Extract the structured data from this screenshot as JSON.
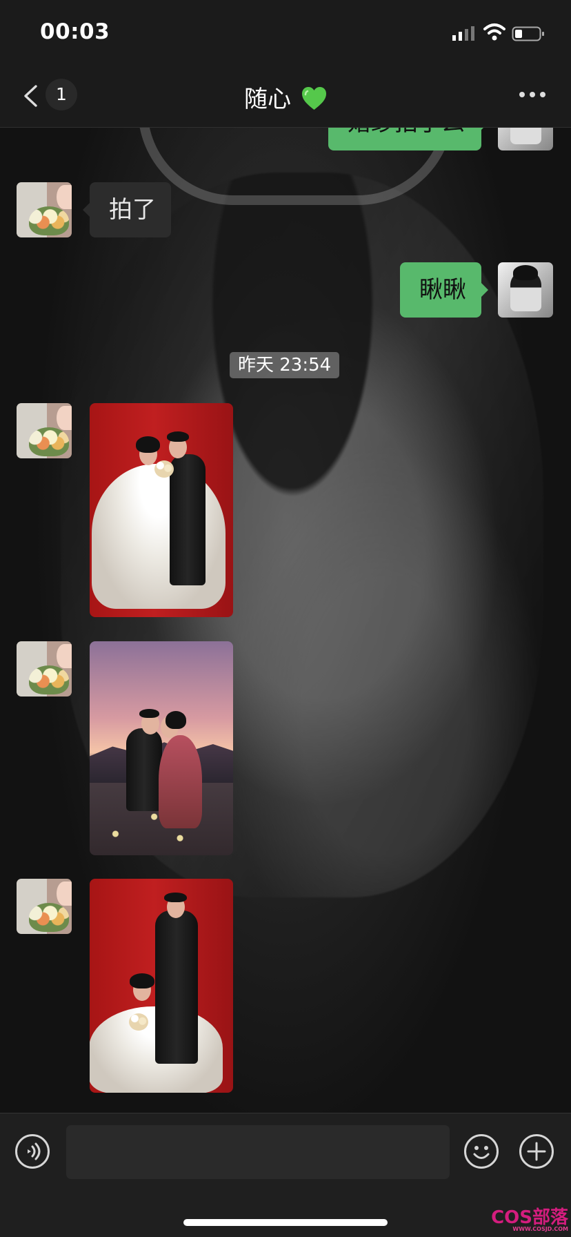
{
  "status_bar": {
    "time": "00:03",
    "icons": [
      "cellular-signal-icon",
      "wifi-icon",
      "battery-icon"
    ]
  },
  "header": {
    "unread_count": "1",
    "title": "随心",
    "title_emoji": "green-heart-icon",
    "more_icon": "more-icon"
  },
  "chat": {
    "messages": [
      {
        "type": "text",
        "direction": "outgoing",
        "text": "婚纱拍了么",
        "avatar": "self-avatar"
      },
      {
        "type": "text",
        "direction": "incoming",
        "text": "拍了",
        "avatar": "friend-avatar"
      },
      {
        "type": "text",
        "direction": "outgoing",
        "text": "瞅瞅",
        "avatar": "self-avatar"
      },
      {
        "type": "timestamp",
        "text": "昨天 23:54"
      },
      {
        "type": "image",
        "direction": "incoming",
        "image": "wedding-photo-red-studio",
        "avatar": "friend-avatar"
      },
      {
        "type": "image",
        "direction": "incoming",
        "image": "wedding-photo-sunset-kiss",
        "avatar": "friend-avatar"
      },
      {
        "type": "image",
        "direction": "incoming",
        "image": "wedding-photo-red-seated",
        "avatar": "friend-avatar"
      }
    ]
  },
  "input_bar": {
    "voice_icon": "voice-icon",
    "input_value": "",
    "emoji_icon": "emoji-icon",
    "plus_icon": "plus-icon"
  },
  "watermark": {
    "brand": "COS部落",
    "url": "WWW.COSJD.COM"
  },
  "colors": {
    "background": "#111111",
    "navigation": "#1b1b1b",
    "incoming_bubble": "#2c2c2c",
    "outgoing_bubble": "#58b96c",
    "watermark": "#d41d7e"
  }
}
